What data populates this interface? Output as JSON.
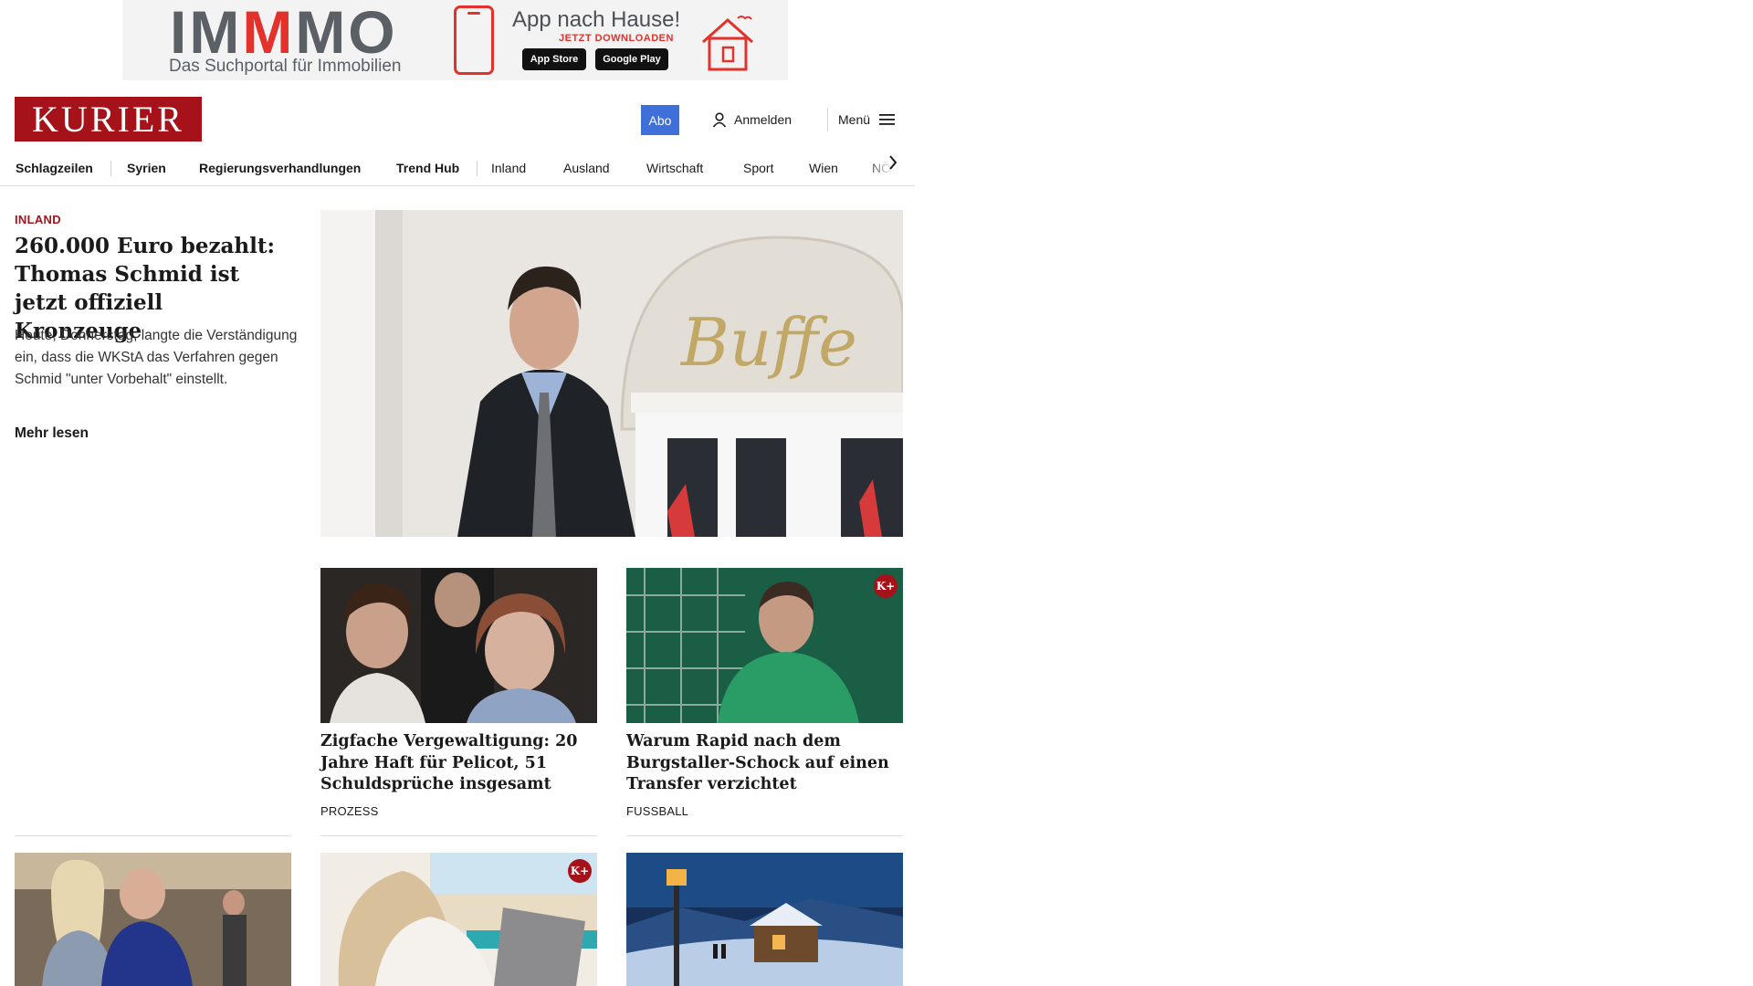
{
  "ad": {
    "logo_part1": "IM",
    "logo_part2": "M",
    "logo_part3": "MO",
    "subtitle": "Das Suchportal für Immobilien",
    "title": "App nach Hause!",
    "cta": "JETZT DOWNLOADEN",
    "apple": "App Store",
    "google": "Google Play"
  },
  "header": {
    "logo": "KURIER",
    "abo": "Abo",
    "login": "Anmelden",
    "menu": "Menü"
  },
  "nav": {
    "items": [
      "Schlagzeilen",
      "Syrien",
      "Regierungsverhandlungen",
      "Trend Hub",
      "Inland",
      "Ausland",
      "Wirtschaft",
      "Sport",
      "Wien",
      "NÖ"
    ]
  },
  "hero": {
    "category": "INLAND",
    "title": "260.000 Euro bezahlt: Thomas Schmid ist jetzt offiziell Kronzeuge",
    "teaser": "Heute, Donnerstag, langte die Verständigung ein, dass die WKStA das Verfahren gegen Schmid \"unter Vorbehalt\" einstellt.",
    "more": "Mehr lesen",
    "image_sign": "Buffe"
  },
  "cards": [
    {
      "title": "Zigfache Vergewaltigung: 20 Jahre Haft für Pelicot, 51 Schuldsprüche insgesamt",
      "category": "PROZESS",
      "premium": false
    },
    {
      "title": "Warum Rapid nach dem Burgstal­ler-Schock auf einen Transfer verzichtet",
      "category": "FUSSBALL",
      "premium": true,
      "badge": "K+"
    }
  ],
  "row3": [
    {
      "premium": false
    },
    {
      "premium": true,
      "badge": "K+"
    },
    {
      "premium": false
    }
  ],
  "colors": {
    "brand": "#a5121a",
    "abo": "#3f6fd8"
  }
}
